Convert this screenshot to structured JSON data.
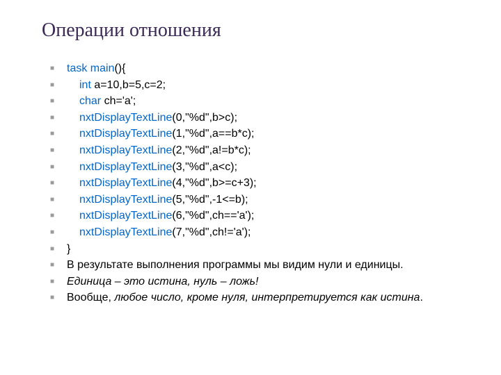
{
  "title": "Операции отношения",
  "lines": {
    "l0_a": "task main",
    "l0_b": "(){",
    "l1_a": "int",
    "l1_b": " a=10,b=5,c=2;",
    "l2_a": "char",
    "l2_b": " ch='a';",
    "l3_a": "nxtDisplayTextLine",
    "l3_b": "(0,\"%d\",b>c);",
    "l4_a": "nxtDisplayTextLine",
    "l4_b": "(1,\"%d\",a==b*c);",
    "l5_a": "nxtDisplayTextLine",
    "l5_b": "(2,\"%d\",a!=b*c);",
    "l6_a": "nxtDisplayTextLine",
    "l6_b": "(3,\"%d\",a<c);",
    "l7_a": "nxtDisplayTextLine",
    "l7_b": "(4,\"%d\",b>=c+3);",
    "l8_a": "nxtDisplayTextLine",
    "l8_b": "(5,\"%d\",-1<=b);",
    "l9_a": "nxtDisplayTextLine",
    "l9_b": "(6,\"%d\",ch=='a');",
    "l10_a": "nxtDisplayTextLine",
    "l10_b": "(7,\"%d\",ch!='a');",
    "l11": "}",
    "l12": "В результате выполнения программы мы видим нули и единицы.",
    "l13": "Единица – это истина, нуль – ложь!",
    "l14_a": "Вообще, ",
    "l14_b": "любое число, кроме нуля, интерпретируется как истина",
    "l14_c": "."
  }
}
